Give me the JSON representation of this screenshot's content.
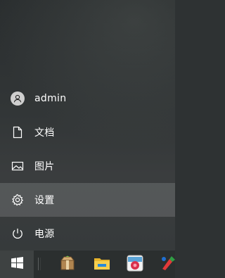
{
  "menu": {
    "items": [
      {
        "label": "admin",
        "icon": "user-icon"
      },
      {
        "label": "文档",
        "icon": "document-icon"
      },
      {
        "label": "图片",
        "icon": "image-icon"
      },
      {
        "label": "设置",
        "icon": "gear-icon"
      },
      {
        "label": "电源",
        "icon": "power-icon"
      }
    ]
  },
  "taskbar": {
    "start_icon": "windows-logo-icon",
    "apps": [
      {
        "icon": "package-icon"
      },
      {
        "icon": "file-explorer-icon"
      },
      {
        "icon": "photo-app-icon"
      },
      {
        "icon": "paint-icon"
      }
    ]
  },
  "colors": {
    "panel_bg": "#323637",
    "taskbar_bg": "#2b2f2f",
    "text": "#ffffff",
    "active_highlight": "#4a4e4e"
  }
}
